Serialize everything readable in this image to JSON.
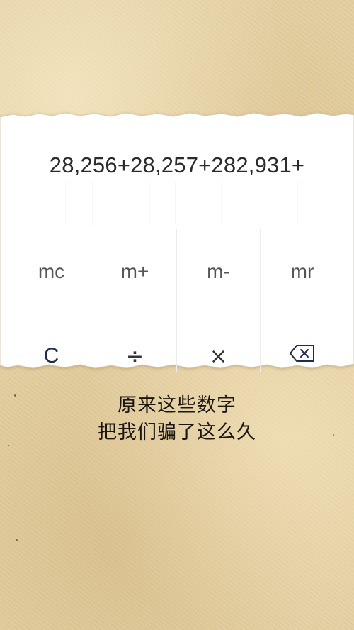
{
  "display": {
    "expression": "28,256+28,257+282,931+"
  },
  "memory_keys": [
    {
      "label": "mc"
    },
    {
      "label": "m+"
    },
    {
      "label": "m-"
    },
    {
      "label": "mr"
    }
  ],
  "operator_keys": [
    {
      "label": "C",
      "icon": "clear-icon"
    },
    {
      "label": "÷",
      "icon": "divide-icon"
    },
    {
      "label": "×",
      "icon": "multiply-icon"
    },
    {
      "label": "",
      "icon": "backspace-icon"
    }
  ],
  "caption": {
    "line1": "原来这些数字",
    "line2": "把我们骗了这么久"
  },
  "colors": {
    "background": "#e3cfa0",
    "strip": "#ffffff",
    "clear_key": "#1f2d4d",
    "operator_key": "#333333"
  }
}
